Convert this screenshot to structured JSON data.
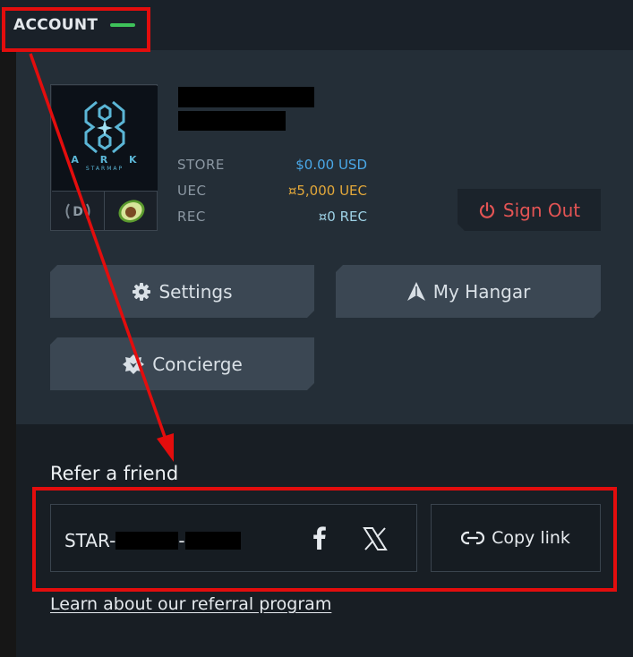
{
  "header": {
    "title": "ACCOUNT"
  },
  "profile": {
    "avatar_logo": {
      "name": "A R K",
      "subtitle": "STARMAP"
    },
    "badges": [
      "D",
      "avocado"
    ]
  },
  "stats": [
    {
      "label": "STORE",
      "value": "$0.00 USD",
      "color": "#4aa8e8"
    },
    {
      "label": "UEC",
      "value": "¤5,000 UEC",
      "color": "#e3a83a"
    },
    {
      "label": "REC",
      "value": "¤0 REC",
      "color": "#9ed2e6"
    }
  ],
  "actions": {
    "sign_out": "Sign Out",
    "settings": "Settings",
    "hangar": "My Hangar",
    "concierge": "Concierge"
  },
  "referral": {
    "title": "Refer a friend",
    "code_prefix": "STAR-",
    "code_sep": "-",
    "copy_label": "Copy link",
    "learn_link": "Learn about our referral program"
  },
  "colors": {
    "accent_green": "#3ec25a",
    "danger_red": "#e35454",
    "highlight_red": "#e30d0d"
  },
  "icons": [
    "power-icon",
    "gear-icon",
    "ship-icon",
    "lion-icon",
    "facebook-icon",
    "x-icon",
    "link-icon"
  ]
}
